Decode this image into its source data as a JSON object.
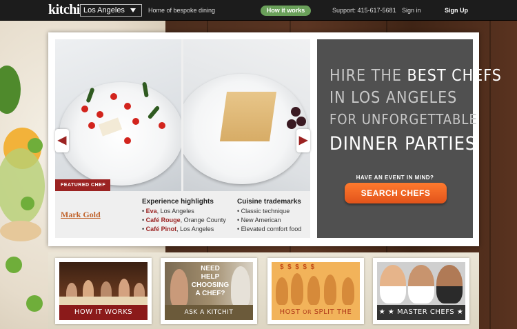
{
  "topbar": {
    "logo": "kitchit",
    "city": "Los Angeles",
    "tagline": "Home of bespoke dining",
    "how_it_works": "How it works",
    "support": "Support: 415-617-5681",
    "sign_in": "Sign in",
    "sign_up": "Sign Up"
  },
  "featured": {
    "label": "FEATURED CHEF",
    "chef_name": "Mark Gold",
    "experience_title": "Experience highlights",
    "experience": [
      {
        "name": "Eva",
        "place": ", Los Angeles"
      },
      {
        "name": "Café Rouge",
        "place": ", Orange County"
      },
      {
        "name": "Café Pinot",
        "place": ", Los Angeles"
      }
    ],
    "trademarks_title": "Cuisine trademarks",
    "trademarks": [
      "Classic technique",
      "New American",
      "Elevated comfort food"
    ]
  },
  "hero": {
    "line1_a": "HIRE THE ",
    "line1_b": "BEST CHEFS",
    "line2": "IN LOS ANGELES",
    "line3": "FOR UNFORGETTABLE",
    "line4": "DINNER PARTIES",
    "event_question": "HAVE AN EVENT IN MIND?",
    "search_button": "SEARCH CHEFS"
  },
  "tiles": [
    {
      "caption": "HOW IT WORKS",
      "caption_color": "#8b1a1a"
    },
    {
      "caption": "ASK A KITCHIT CONCIERGE",
      "overlay": "NEED HELP CHOOSING A CHEF?",
      "caption_color": "#6b5a3a"
    },
    {
      "caption_a": "HOST ",
      "caption_or": "OR",
      "caption_b": " SPLIT THE BILL",
      "caption_color": "#b03a1a"
    },
    {
      "caption": "MASTER CHEFS",
      "stars_left": "★ ★",
      "stars_right": "★ ★",
      "caption_color": "#333333"
    }
  ],
  "colors": {
    "accent_red": "#9b2322",
    "cta_orange": "#e2531a",
    "nav_green": "#6aa05a",
    "chef_orange": "#c0622a"
  }
}
